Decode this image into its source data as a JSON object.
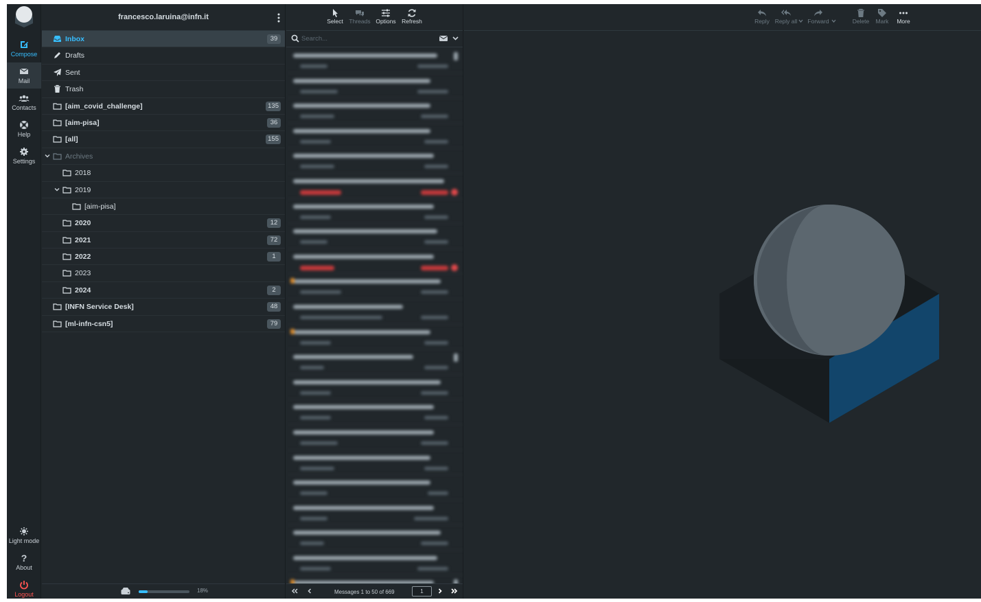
{
  "account": {
    "email": "francesco.laruina@infn.it"
  },
  "nav": {
    "compose": "Compose",
    "mail": "Mail",
    "contacts": "Contacts",
    "help": "Help",
    "settings": "Settings",
    "light_mode": "Light mode",
    "about": "About",
    "logout": "Logout"
  },
  "folders": [
    {
      "name": "Inbox",
      "count": "39",
      "icon": "inbox-icon",
      "selected": true,
      "bold": true
    },
    {
      "name": "Drafts",
      "count": "",
      "icon": "pencil-icon"
    },
    {
      "name": "Sent",
      "count": "",
      "icon": "paper-plane-icon"
    },
    {
      "name": "Trash",
      "count": "",
      "icon": "trash-icon"
    },
    {
      "name": "[aim_covid_challenge]",
      "count": "135",
      "icon": "folder-icon",
      "bold": true
    },
    {
      "name": "[aim-pisa]",
      "count": "36",
      "icon": "folder-icon",
      "bold": true
    },
    {
      "name": "[all]",
      "count": "155",
      "icon": "folder-icon",
      "bold": true
    },
    {
      "name": "Archives",
      "count": "",
      "icon": "folder-icon",
      "dim": true,
      "expanded": true
    },
    {
      "name": "2018",
      "count": "",
      "icon": "folder-icon",
      "level": 1
    },
    {
      "name": "2019",
      "count": "",
      "icon": "folder-icon",
      "level": 1,
      "expanded": true
    },
    {
      "name": "[aim-pisa]",
      "count": "",
      "icon": "folder-icon",
      "level": 2
    },
    {
      "name": "2020",
      "count": "12",
      "icon": "folder-icon",
      "level": 1,
      "bold": true
    },
    {
      "name": "2021",
      "count": "72",
      "icon": "folder-icon",
      "level": 1,
      "bold": true
    },
    {
      "name": "2022",
      "count": "1",
      "icon": "folder-icon",
      "level": 1,
      "bold": true
    },
    {
      "name": "2023",
      "count": "",
      "icon": "folder-icon",
      "level": 1
    },
    {
      "name": "2024",
      "count": "2",
      "icon": "folder-icon",
      "level": 1,
      "bold": true
    },
    {
      "name": "[INFN Service Desk]",
      "count": "48",
      "icon": "folder-icon",
      "bold": true
    },
    {
      "name": "[ml-infn-csn5]",
      "count": "79",
      "icon": "folder-icon",
      "bold": true
    }
  ],
  "quota": {
    "percent": "18%",
    "fraction": 0.18
  },
  "list_toolbar": {
    "select": "Select",
    "threads": "Threads",
    "options": "Options",
    "refresh": "Refresh"
  },
  "search": {
    "placeholder": "Search..."
  },
  "list_footer": {
    "count_text": "Messages 1 to 50 of 669",
    "page": "1"
  },
  "message_toolbar": {
    "reply": "Reply",
    "reply_all": "Reply all",
    "forward": "Forward",
    "delete": "Delete",
    "mark": "Mark",
    "more": "More"
  },
  "colors": {
    "accent": "#37beff",
    "background": "#21272b",
    "logout": "#ff5552",
    "flagged": "#c4393b"
  }
}
